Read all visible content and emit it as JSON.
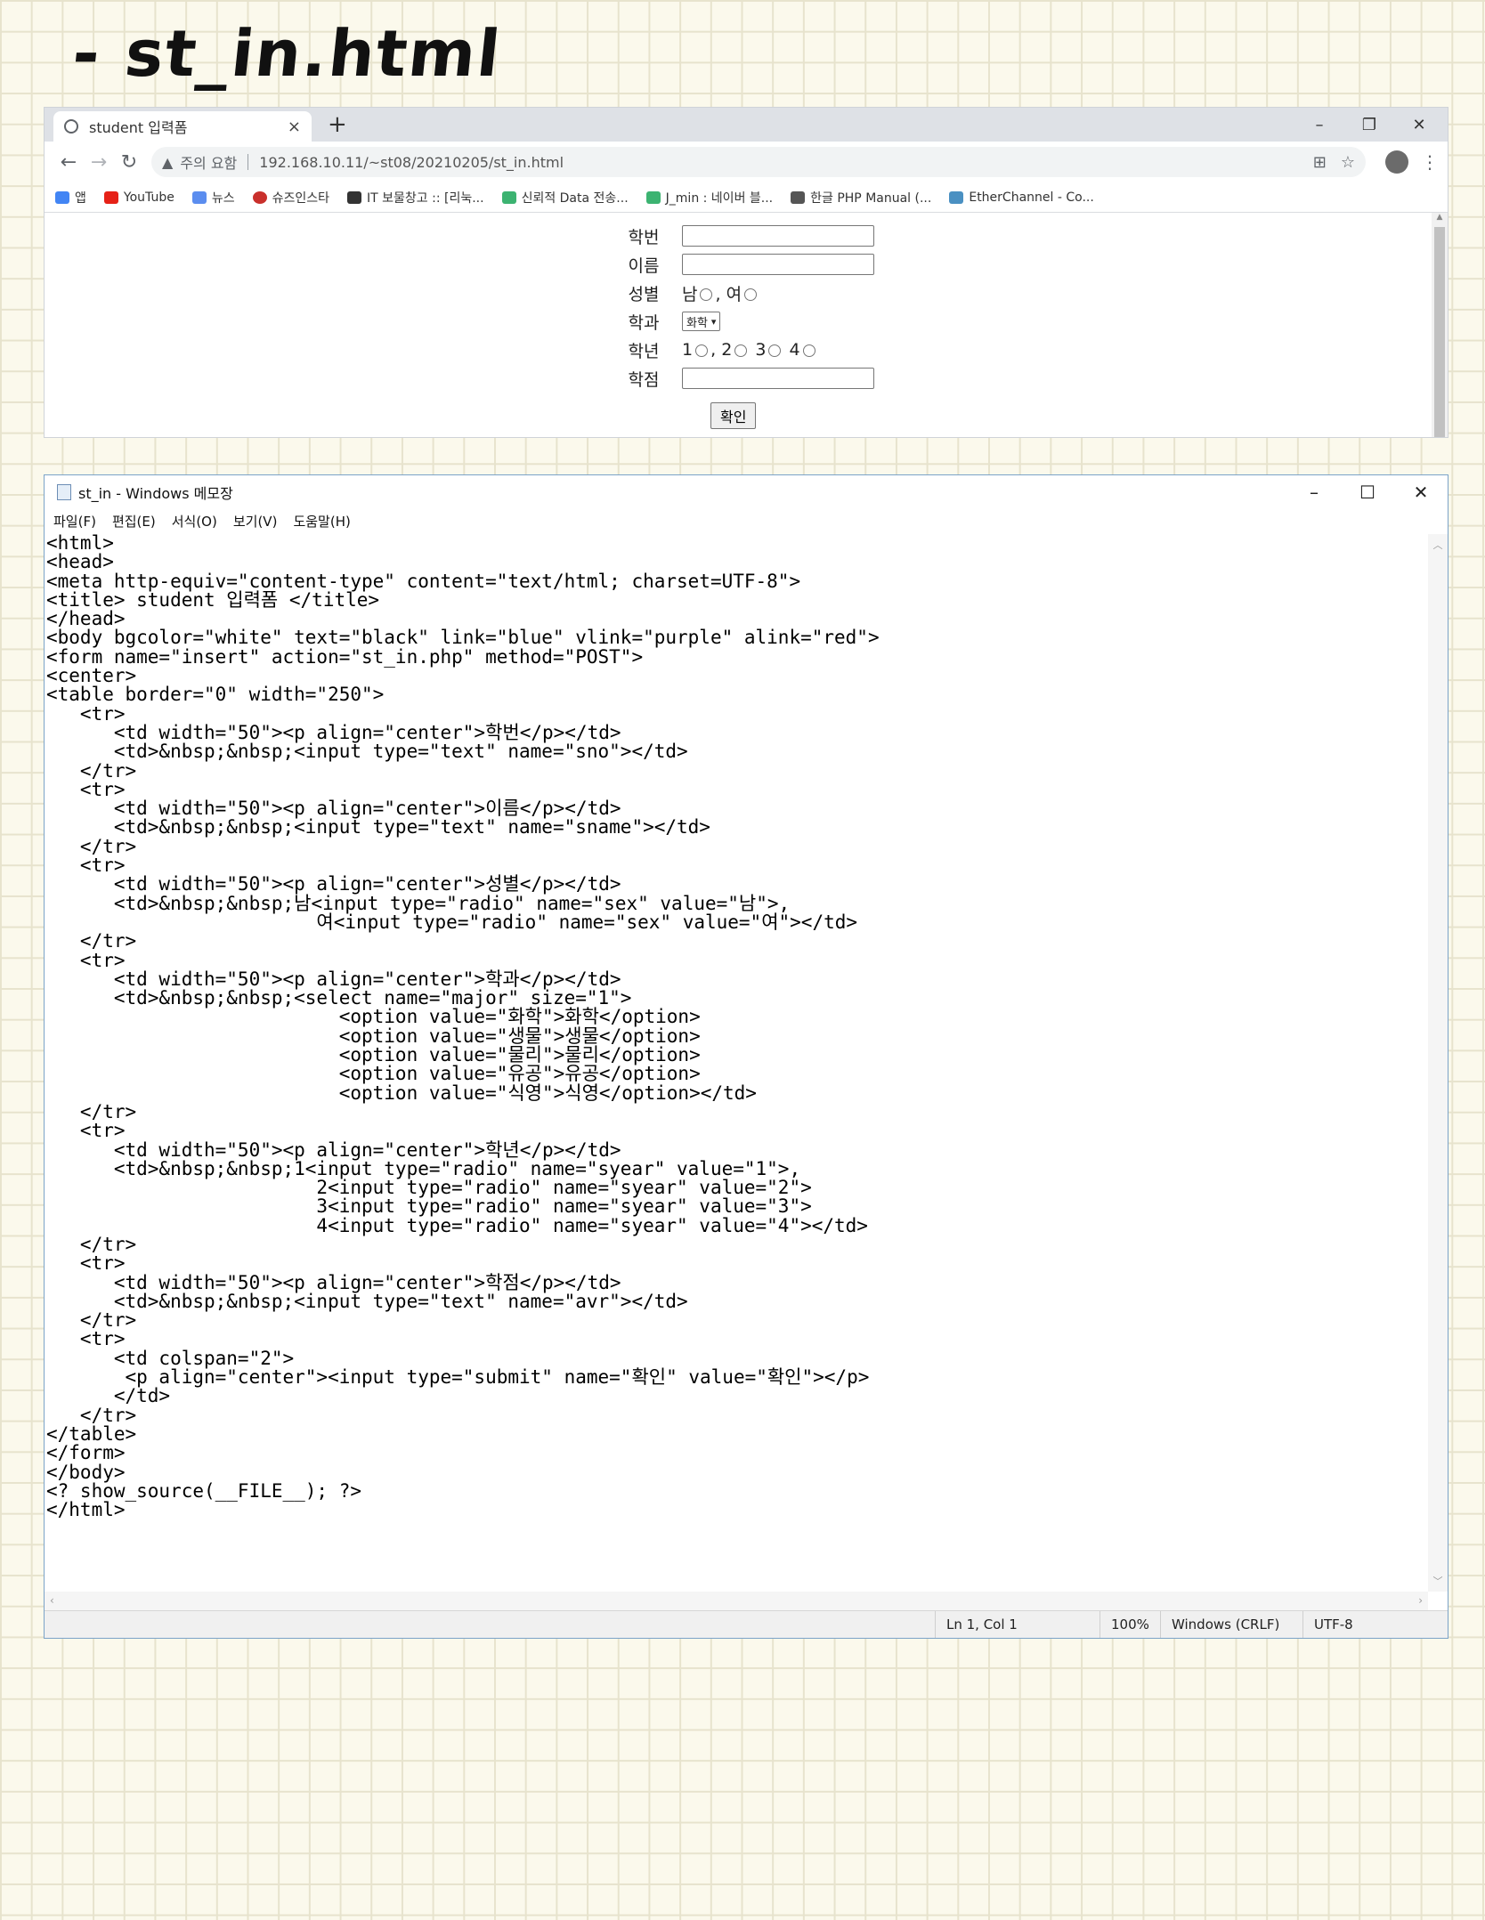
{
  "heading": "- st_in.html",
  "browser": {
    "tab_title": "student 입력폼",
    "tab_close": "×",
    "new_tab": "+",
    "window_controls": [
      "–",
      "❐",
      "✕"
    ],
    "nav": {
      "back": "←",
      "forward": "→",
      "reload": "↻"
    },
    "security_icon": "▲",
    "security_text": "주의 요함",
    "url": "192.168.10.11/~st08/20210205/st_in.html",
    "translate_icon": "⊞",
    "star_icon": "☆",
    "menu_icon": "⋮",
    "bookmarks": [
      {
        "label": "앱",
        "color": "#4285f4"
      },
      {
        "label": "YouTube",
        "color": "#e62117"
      },
      {
        "label": "뉴스",
        "color": "#5b8def"
      },
      {
        "label": "슈즈인스타",
        "color": "#c9302c"
      },
      {
        "label": "IT 보물창고 :: [리눅...",
        "color": "#333333"
      },
      {
        "label": "신뢰적 Data 전송...",
        "color": "#3cb371"
      },
      {
        "label": "J_min : 네이버 블...",
        "color": "#3cb371"
      },
      {
        "label": "한글 PHP Manual (...",
        "color": "#555555"
      },
      {
        "label": "EtherChannel - Co...",
        "color": "#4a90c2"
      }
    ],
    "form": {
      "sno_label": "학번",
      "sname_label": "이름",
      "sex_label": "성별",
      "sex_male": "남",
      "sex_sep": ",",
      "sex_female": "여",
      "major_label": "학과",
      "major_selected": "화학",
      "year_label": "학년",
      "year_options": [
        "1",
        "2",
        "3",
        "4"
      ],
      "avr_label": "학점",
      "submit": "확인"
    }
  },
  "notepad": {
    "title": "st_in - Windows 메모장",
    "window_controls": [
      "–",
      "☐",
      "✕"
    ],
    "menu": [
      "파일(F)",
      "편집(E)",
      "서식(O)",
      "보기(V)",
      "도움말(H)"
    ],
    "code": "<html>\n<head>\n<meta http-equiv=\"content-type\" content=\"text/html; charset=UTF-8\">\n<title> student 입력폼 </title>\n</head>\n<body bgcolor=\"white\" text=\"black\" link=\"blue\" vlink=\"purple\" alink=\"red\">\n<form name=\"insert\" action=\"st_in.php\" method=\"POST\">\n<center>\n<table border=\"0\" width=\"250\">\n   <tr>\n      <td width=\"50\"><p align=\"center\">학번</p></td>\n      <td>&nbsp;&nbsp;<input type=\"text\" name=\"sno\"></td>\n   </tr>\n   <tr>\n      <td width=\"50\"><p align=\"center\">이름</p></td>\n      <td>&nbsp;&nbsp;<input type=\"text\" name=\"sname\"></td>\n   </tr>\n   <tr>\n      <td width=\"50\"><p align=\"center\">성별</p></td>\n      <td>&nbsp;&nbsp;남<input type=\"radio\" name=\"sex\" value=\"남\">,\n                        여<input type=\"radio\" name=\"sex\" value=\"여\"></td>\n   </tr>\n   <tr>\n      <td width=\"50\"><p align=\"center\">학과</p></td>\n      <td>&nbsp;&nbsp;<select name=\"major\" size=\"1\">\n                          <option value=\"화학\">화학</option>\n                          <option value=\"생물\">생물</option>\n                          <option value=\"물리\">물리</option>\n                          <option value=\"유공\">유공</option>\n                          <option value=\"식영\">식영</option></td>\n   </tr>\n   <tr>\n      <td width=\"50\"><p align=\"center\">학년</p></td>\n      <td>&nbsp;&nbsp;1<input type=\"radio\" name=\"syear\" value=\"1\">,\n                        2<input type=\"radio\" name=\"syear\" value=\"2\">\n                        3<input type=\"radio\" name=\"syear\" value=\"3\">\n                        4<input type=\"radio\" name=\"syear\" value=\"4\"></td>\n   </tr>\n   <tr>\n      <td width=\"50\"><p align=\"center\">학점</p></td>\n      <td>&nbsp;&nbsp;<input type=\"text\" name=\"avr\"></td>\n   </tr>\n   <tr>\n      <td colspan=\"2\">\n       <p align=\"center\"><input type=\"submit\" name=\"확인\" value=\"확인\"></p>\n      </td>\n   </tr>\n</table>\n</form>\n</body>\n<? show_source(__FILE__); ?>\n</html>",
    "status": {
      "position": "Ln 1, Col 1",
      "zoom": "100%",
      "line_ending": "Windows (CRLF)",
      "encoding": "UTF-8"
    }
  }
}
